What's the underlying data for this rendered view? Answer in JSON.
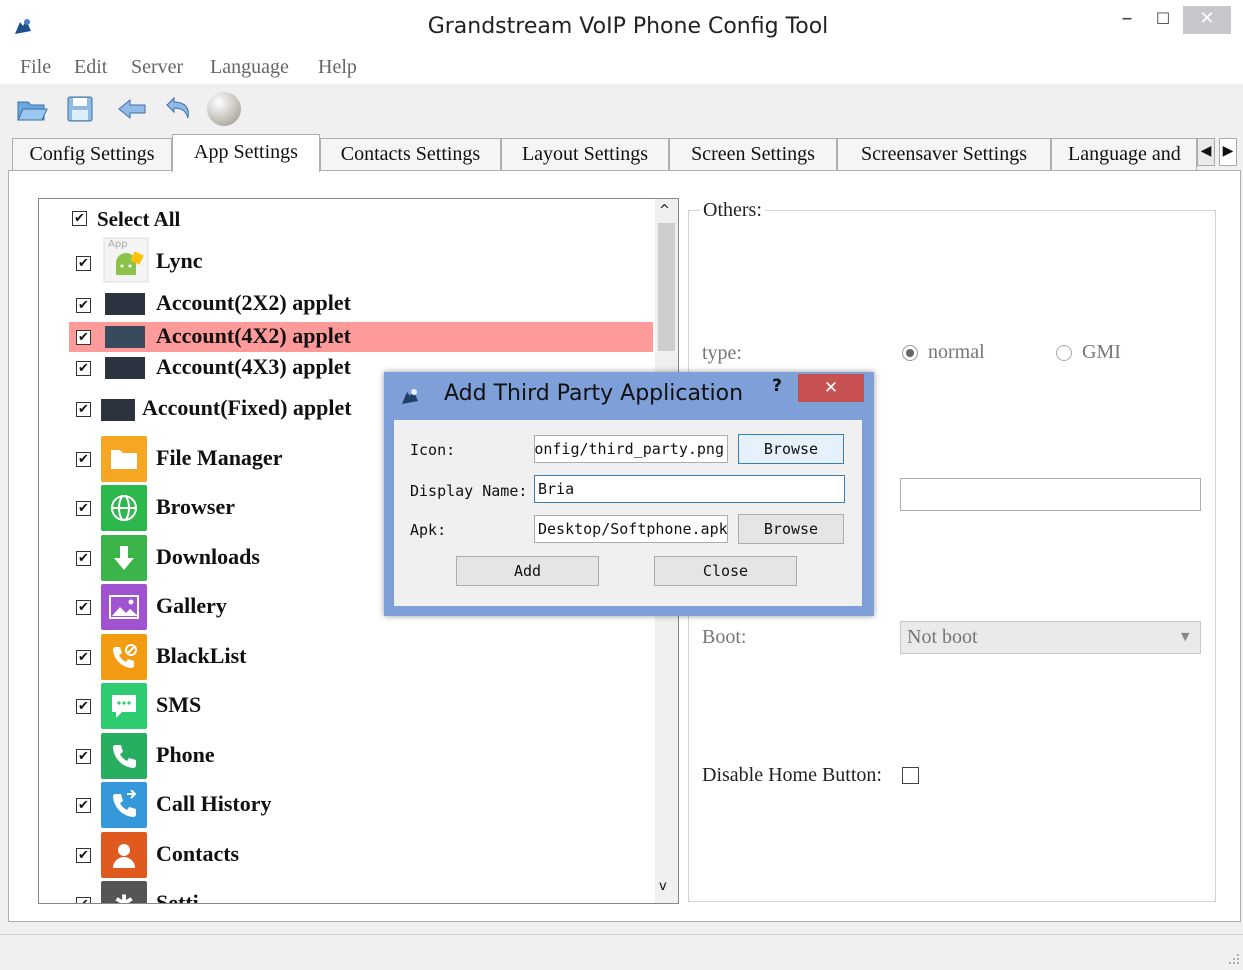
{
  "window": {
    "title": "Grandstream VoIP Phone Config Tool",
    "minimize": "–",
    "maximize": "☐",
    "close": "✕"
  },
  "menu": {
    "items": [
      "File",
      "Edit",
      "Server",
      "Language",
      "Help"
    ]
  },
  "toolbar": {
    "icons": [
      "open-folder-icon",
      "save-icon",
      "back-arrow-icon",
      "undo-icon",
      "sphere-icon"
    ]
  },
  "tabs": {
    "items": [
      "Config Settings",
      "App Settings",
      "Contacts Settings",
      "Layout Settings",
      "Screen Settings",
      "Screensaver Settings",
      "Language and"
    ],
    "active": "App Settings"
  },
  "app_list": {
    "select_all": "Select All",
    "check": "✔",
    "items": [
      {
        "label": "Lync",
        "checked": true,
        "icon": "android-app-icon"
      },
      {
        "label": "Account(2X2) applet",
        "checked": true,
        "icon": "account-applet-icon"
      },
      {
        "label": "Account(4X2) applet",
        "checked": true,
        "icon": "account-applet-icon",
        "selected": true
      },
      {
        "label": "Account(4X3) applet",
        "checked": true,
        "icon": "account-applet-icon"
      },
      {
        "label": "Account(Fixed) applet",
        "checked": true,
        "icon": "account-applet-icon"
      },
      {
        "label": "File Manager",
        "checked": true,
        "icon": "folder-icon",
        "color": "#f5a623"
      },
      {
        "label": "Browser",
        "checked": true,
        "icon": "globe-icon",
        "color": "#2db84d"
      },
      {
        "label": "Downloads",
        "checked": true,
        "icon": "download-icon",
        "color": "#3bb54a"
      },
      {
        "label": "Gallery",
        "checked": true,
        "icon": "image-icon",
        "color": "#a052d1"
      },
      {
        "label": "BlackList",
        "checked": true,
        "icon": "blocked-call-icon",
        "color": "#f39c12"
      },
      {
        "label": "SMS",
        "checked": true,
        "icon": "chat-icon",
        "color": "#2ecc71"
      },
      {
        "label": "Phone",
        "checked": true,
        "icon": "phone-icon",
        "color": "#27ae60"
      },
      {
        "label": "Call History",
        "checked": true,
        "icon": "call-history-icon",
        "color": "#3498db"
      },
      {
        "label": "Contacts",
        "checked": true,
        "icon": "contact-icon",
        "color": "#e05a1f"
      },
      {
        "label": "Setti",
        "checked": true,
        "icon": "gear-icon",
        "color": "#555555"
      }
    ]
  },
  "others": {
    "legend": "Others:",
    "type_label": "type:",
    "type_options": [
      {
        "label": "normal",
        "selected": true
      },
      {
        "label": "GMI",
        "selected": false
      }
    ],
    "boot_label": "Boot:",
    "boot_value": "Not boot",
    "disable_home_label": "Disable Home Button:",
    "disable_home_checked": false
  },
  "dialog": {
    "title": "Add Third Party Application",
    "help": "?",
    "close": "✕",
    "icon_label": "Icon:",
    "icon_value": "onfig/third_party.png",
    "display_name_label": "Display Name:",
    "display_name_value": "Bria",
    "apk_label": "Apk:",
    "apk_value": "Desktop/Softphone.apk",
    "browse_label": "Browse",
    "add_label": "Add",
    "close_label": "Close"
  },
  "colors": {
    "selected_row": "#ff9a9a",
    "dialog_frame": "#7e9fd8",
    "close_button": "#c75050"
  }
}
